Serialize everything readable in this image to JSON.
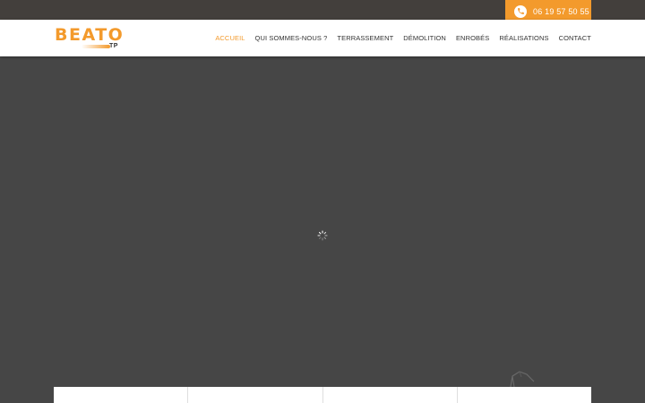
{
  "topbar": {
    "phone_number": "06 19 57 50 55"
  },
  "logo": {
    "name": "BEATO",
    "sub": "TP"
  },
  "nav": {
    "items": [
      {
        "label": "ACCUEIL",
        "active": true
      },
      {
        "label": "QUI SOMMES-NOUS ?",
        "active": false
      },
      {
        "label": "TERRASSEMENT",
        "active": false
      },
      {
        "label": "DÉMOLITION",
        "active": false
      },
      {
        "label": "ENROBÉS",
        "active": false
      },
      {
        "label": "RÉALISATIONS",
        "active": false
      },
      {
        "label": "CONTACT",
        "active": false
      }
    ]
  },
  "colors": {
    "accent": "#f39a2c",
    "topbar": "#433f3c",
    "hero": "#464646"
  },
  "icons": {
    "phone": "phone-icon",
    "loader": "loading-spinner-icon"
  }
}
